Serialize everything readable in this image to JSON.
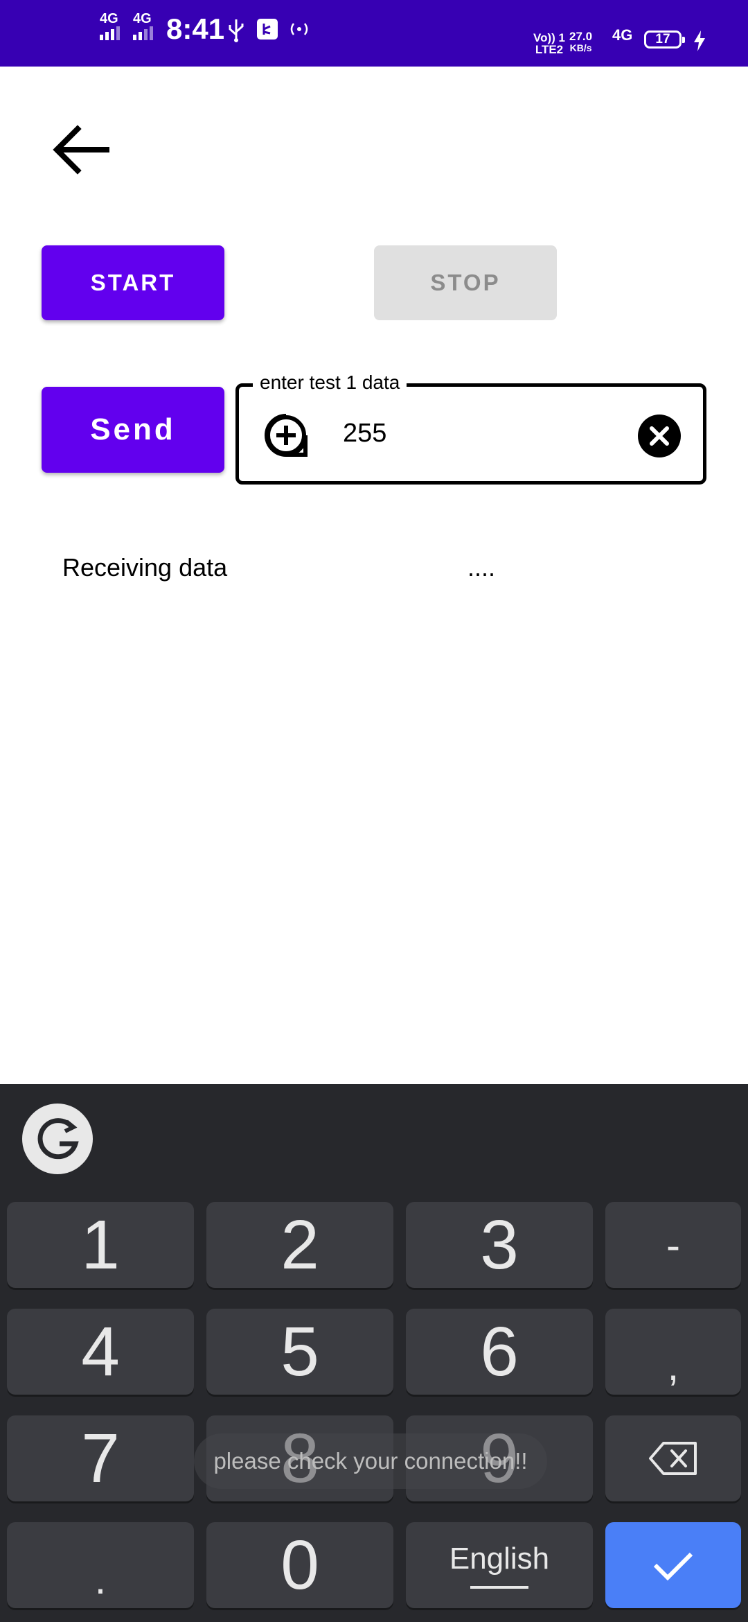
{
  "status_bar": {
    "sim1": "4G",
    "sim2": "4G",
    "time": "8:41",
    "volte_line1": "Vo)) 1",
    "volte_line2": "LTE2",
    "speed_value": "27.0",
    "speed_unit": "KB/s",
    "network": "4G",
    "battery": "17",
    "colors": {
      "background": "#3700B3"
    }
  },
  "toolbar": {
    "back_icon": "arrow-back-icon"
  },
  "controls": {
    "start_label": "START",
    "stop_label": "STOP",
    "send_label": "Send",
    "colors": {
      "primary": "#6200EE",
      "disabled": "#E0E0E0"
    }
  },
  "input": {
    "label": "enter test 1 data",
    "value": "255",
    "leading_icon": "add-circle-icon",
    "trailing_icon": "clear-icon"
  },
  "receive": {
    "label": "Receiving data",
    "value": "...."
  },
  "keyboard": {
    "logo_icon": "grammarly-g-icon",
    "keys": {
      "k1": "1",
      "k2": "2",
      "k3": "3",
      "dash": "-",
      "k4": "4",
      "k5": "5",
      "k6": "6",
      "comma": ",",
      "k7": "7",
      "k8": "8",
      "k9": "9",
      "dot": ".",
      "k0": "0",
      "language": "English"
    },
    "backspace_icon": "backspace-icon",
    "enter_icon": "check-icon",
    "colors": {
      "background": "#27282C",
      "key": "#3B3C41",
      "enter": "#4A7FF7"
    }
  },
  "toast": {
    "message": "please check your connection!!"
  }
}
